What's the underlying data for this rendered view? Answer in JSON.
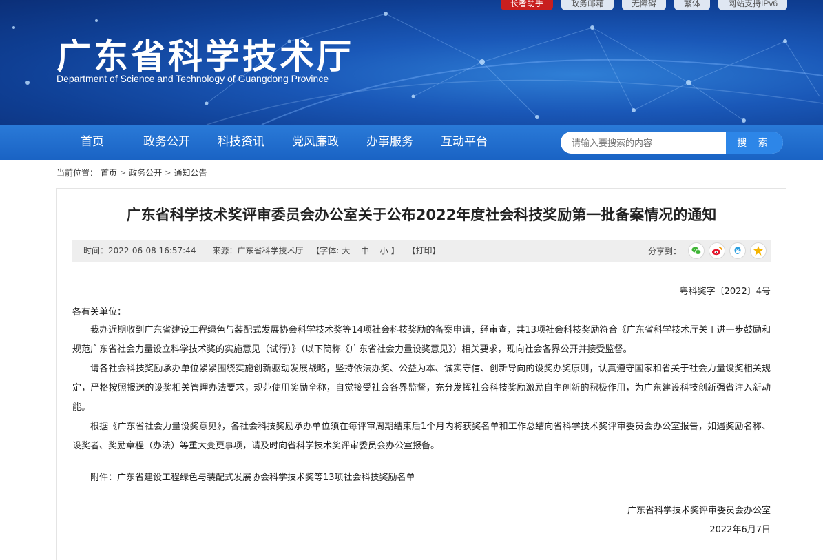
{
  "top_links": [
    "长者助手",
    "政务邮箱",
    "无障碍",
    "繁体",
    "网站支持IPv6"
  ],
  "site": {
    "title": "广东省科学技术厅",
    "subtitle": "Department of Science and Technology of Guangdong Province"
  },
  "nav": {
    "items": [
      "首页",
      "政务公开",
      "科技资讯",
      "党风廉政",
      "办事服务",
      "互动平台"
    ]
  },
  "search": {
    "placeholder": "请输入要搜索的内容",
    "button": "搜 索"
  },
  "breadcrumb": {
    "prefix": "当前位置：",
    "items": [
      "首页",
      "政务公开",
      "通知公告"
    ],
    "separator": ">"
  },
  "article": {
    "title": "广东省科学技术奖评审委员会办公室关于公布2022年度社会科技奖励第一批备案情况的通知",
    "meta": {
      "time": "时间：2022-06-08 16:57:44",
      "source": "来源：广东省科学技术厅",
      "font_open": "【字体:",
      "font_large": "大",
      "font_medium": "中",
      "font_small": "小",
      "font_close": "】",
      "print": "【打印】",
      "share_label": "分享到："
    },
    "share_icons": [
      "wechat-icon",
      "weibo-icon",
      "qq-icon",
      "qzone-icon"
    ],
    "doc_number": "粤科奖字〔2022〕4号",
    "salutation": "各有关单位：",
    "paragraphs": [
      "我办近期收到广东省建设工程绿色与装配式发展协会科学技术奖等14项社会科技奖励的备案申请，经审查，共13项社会科技奖励符合《广东省科学技术厅关于进一步鼓励和规范广东省社会力量设立科学技术奖的实施意见（试行）》（以下简称《广东省社会力量设奖意见》）相关要求，现向社会各界公开并接受监督。",
      "请各社会科技奖励承办单位紧紧围绕实施创新驱动发展战略，坚持依法办奖、公益为本、诚实守信、创新导向的设奖办奖原则，认真遵守国家和省关于社会力量设奖相关规定，严格按照报送的设奖相关管理办法要求，规范使用奖励全称，自觉接受社会各界监督，充分发挥社会科技奖励激励自主创新的积极作用，为广东建设科技创新强省注入新动能。",
      "根据《广东省社会力量设奖意见》，各社会科技奖励承办单位须在每评审周期结束后1个月内将获奖名单和工作总结向省科学技术奖评审委员会办公室报告，如遇奖励名称、设奖者、奖励章程（办法）等重大变更事项，请及时向省科学技术奖评审委员会办公室报备。"
    ],
    "attachment": "附件：广东省建设工程绿色与装配式发展协会科学技术奖等13项社会科技奖励名单",
    "signature": "广东省科学技术奖评审委员会办公室",
    "date": "2022年6月7日"
  },
  "colors": {
    "banner_dark": "#0f3f94",
    "nav_blue": "#1a63c4",
    "search_button": "#2d86e8",
    "elder_red": "#c81f1f",
    "wechat": "#3fb536",
    "weibo": "#e6162d",
    "qq": "#2b9fe0",
    "qzone": "#f5b400"
  }
}
